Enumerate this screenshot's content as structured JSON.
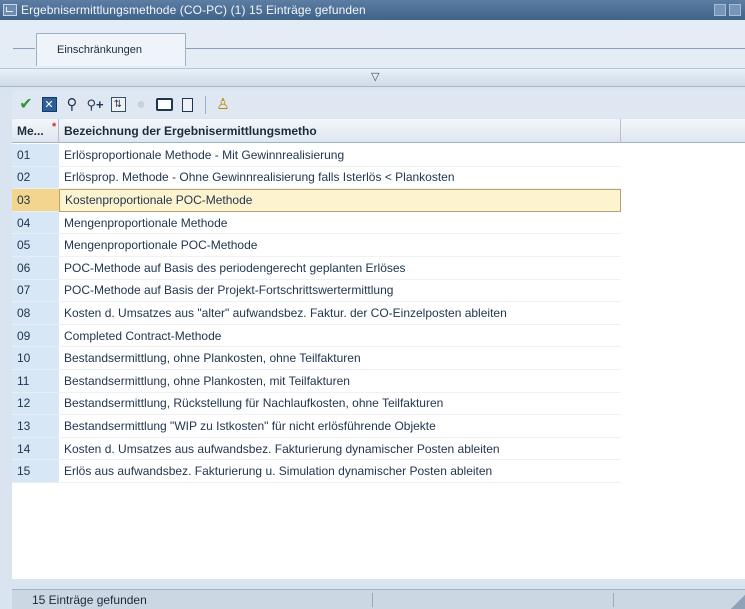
{
  "window": {
    "title": "Ergebnisermittlungsmethode (CO-PC) (1)   15 Einträge gefunden"
  },
  "tabs": [
    {
      "label": "Einschränkungen"
    }
  ],
  "toolbar": {
    "icons": [
      "check-icon",
      "cancel-icon",
      "find-icon",
      "find-next-icon",
      "sort-icon",
      "help-icon",
      "print-icon",
      "document-icon",
      "person-icon"
    ]
  },
  "table": {
    "headers": [
      "Me...",
      "Bezeichnung der Ergebnisermittlungsmetho"
    ],
    "required_marker": "*",
    "selected_index": 2,
    "rows": [
      {
        "key": "01",
        "text": "Erlösproportionale Methode - Mit Gewinnrealisierung"
      },
      {
        "key": "02",
        "text": "Erlösprop. Methode - Ohne Gewinnrealisierung falls Isterlös < Plankosten"
      },
      {
        "key": "03",
        "text": "Kostenproportionale POC-Methode"
      },
      {
        "key": "04",
        "text": "Mengenproportionale Methode"
      },
      {
        "key": "05",
        "text": "Mengenproportionale POC-Methode"
      },
      {
        "key": "06",
        "text": "POC-Methode auf Basis des periodengerecht geplanten Erlöses"
      },
      {
        "key": "07",
        "text": "POC-Methode auf Basis der Projekt-Fortschrittswertermittlung"
      },
      {
        "key": "08",
        "text": "Kosten d. Umsatzes aus \"alter\" aufwandsbez. Faktur. der CO-Einzelposten ableiten"
      },
      {
        "key": "09",
        "text": "Completed Contract-Methode"
      },
      {
        "key": "10",
        "text": "Bestandsermittlung, ohne Plankosten, ohne Teilfakturen"
      },
      {
        "key": "11",
        "text": "Bestandsermittlung, ohne Plankosten, mit Teilfakturen"
      },
      {
        "key": "12",
        "text": "Bestandsermittlung, Rückstellung für Nachlaufkosten, ohne Teilfakturen"
      },
      {
        "key": "13",
        "text": "Bestandsermittlung \"WIP zu Istkosten\" für nicht erlösführende Objekte"
      },
      {
        "key": "14",
        "text": "Kosten d. Umsatzes aus aufwandsbez. Fakturierung dynamischer Posten ableiten"
      },
      {
        "key": "15",
        "text": "Erlös aus aufwandsbez. Fakturierung u. Simulation dynamischer Posten ableiten"
      }
    ]
  },
  "statusbar": {
    "message": "15 Einträge gefunden"
  },
  "colors": {
    "titlebar": "#4a6d95",
    "key_column": "#d7e7f5",
    "selected_key": "#f3d58e",
    "selected_row": "#fdf4cf"
  }
}
